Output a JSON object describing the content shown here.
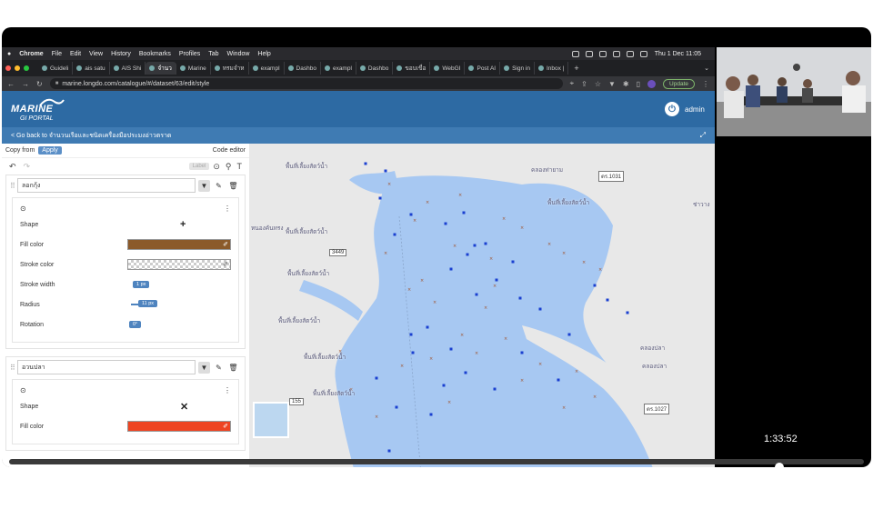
{
  "menubar": {
    "apple": "",
    "items": [
      "Chrome",
      "File",
      "Edit",
      "View",
      "History",
      "Bookmarks",
      "Profiles",
      "Tab",
      "Window",
      "Help"
    ],
    "clock": "Thu 1 Dec  11:05"
  },
  "tabs": [
    {
      "label": "Guideli",
      "active": false
    },
    {
      "label": "ais satu",
      "active": false
    },
    {
      "label": "AIS Shi",
      "active": false
    },
    {
      "label": "จำนว",
      "active": true
    },
    {
      "label": "Marine",
      "active": false
    },
    {
      "label": "ทรมจำห",
      "active": false
    },
    {
      "label": "exampl",
      "active": false
    },
    {
      "label": "Dashbo",
      "active": false
    },
    {
      "label": "exampl",
      "active": false
    },
    {
      "label": "Dashbo",
      "active": false
    },
    {
      "label": "ขอบเขื่อ",
      "active": false
    },
    {
      "label": "WebGI",
      "active": false
    },
    {
      "label": "Post AI",
      "active": false
    },
    {
      "label": "Sign in",
      "active": false
    },
    {
      "label": "Inbox |",
      "active": false
    }
  ],
  "address": {
    "url": "marine.longdo.com/catalogue/#/dataset/63/edit/style",
    "update_label": "Update"
  },
  "header": {
    "logo_line1": "MARINE",
    "logo_line2": "GI PORTAL",
    "user": "admin"
  },
  "subbar": {
    "back_text": "< Go back to จำนวนเรือและชนิดเครื่องมือประมงอ่าวตราด"
  },
  "style_editor": {
    "copy_from": "Copy from",
    "apply": "Apply",
    "code_editor": "Code editor",
    "chip_label": "Label",
    "layers": [
      {
        "name": "ลอกกุ้ง",
        "props": {
          "shape_label": "Shape",
          "shape_glyph": "+",
          "fill_label": "Fill color",
          "fill_color": "#8b5a2b",
          "stroke_color_label": "Stroke color",
          "stroke_width_label": "Stroke width",
          "stroke_width_value": "1 px",
          "radius_label": "Radius",
          "radius_value": "11 px",
          "rotation_label": "Rotation",
          "rotation_value": "0°"
        }
      },
      {
        "name": "อวนปลา",
        "props": {
          "shape_label": "Shape",
          "shape_glyph": "✕",
          "fill_label": "Fill color",
          "fill_color": "#ee4422"
        }
      }
    ]
  },
  "map": {
    "water_color": "#a7c8f2",
    "land_color": "#e8e8e8",
    "places": [
      {
        "text": "คลองท่ายาม"
      },
      {
        "text": "หนองคันทรง"
      },
      {
        "text": "พื้นที่เลี้ยงสัตว์น้ำ"
      },
      {
        "text": "คลองปลา"
      },
      {
        "text": "ช่าวาง"
      }
    ],
    "road_labels": [
      "ตร.1031",
      "3449",
      "155",
      "ตร.1027"
    ]
  },
  "video": {
    "timestamp": "1:33:52"
  }
}
